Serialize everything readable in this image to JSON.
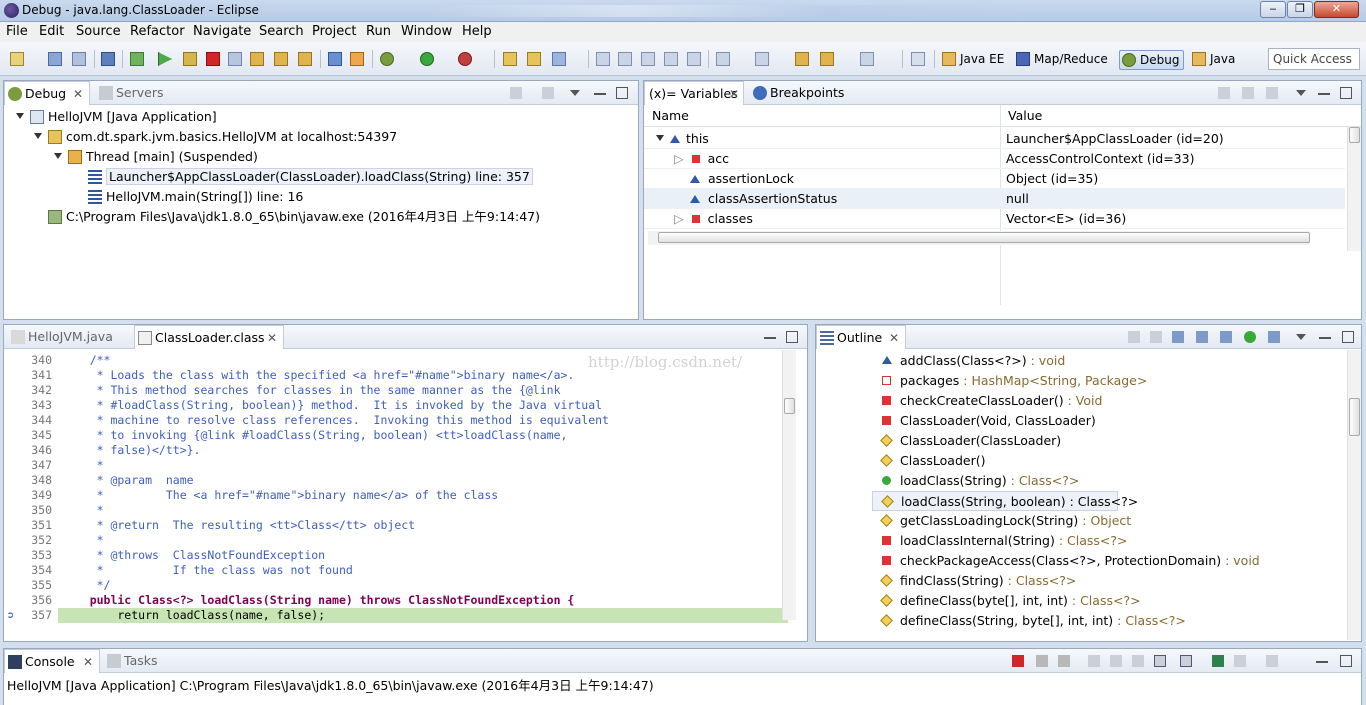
{
  "window": {
    "title": "Debug - java.lang.ClassLoader - Eclipse",
    "minimize": "‒",
    "maximize": "❐",
    "close": "✕"
  },
  "menu": [
    "File",
    "Edit",
    "Source",
    "Refactor",
    "Navigate",
    "Search",
    "Project",
    "Run",
    "Window",
    "Help"
  ],
  "perspectives": [
    "Java EE",
    "Map/Reduce",
    "Debug",
    "Java"
  ],
  "quick_access": "Quick Access",
  "debug_panel": {
    "tabs": [
      "Debug",
      "Servers"
    ],
    "tree": [
      "HelloJVM [Java Application]",
      "com.dt.spark.jvm.basics.HelloJVM at localhost:54397",
      "Thread [main] (Suspended)",
      "Launcher$AppClassLoader(ClassLoader).loadClass(String) line: 357",
      "HelloJVM.main(String[]) line: 16",
      "C:\\Program Files\\Java\\jdk1.8.0_65\\bin\\javaw.exe (2016年4月3日 上午9:14:47)"
    ]
  },
  "variables_panel": {
    "tabs": [
      "(x)= Variables",
      "Breakpoints"
    ],
    "columns": [
      "Name",
      "Value"
    ],
    "rows": [
      {
        "name": "this",
        "value": "Launcher$AppClassLoader  (id=20)"
      },
      {
        "name": "acc",
        "value": "AccessControlContext  (id=33)"
      },
      {
        "name": "assertionLock",
        "value": "Object  (id=35)"
      },
      {
        "name": "classAssertionStatus",
        "value": "null"
      },
      {
        "name": "classes",
        "value": "Vector<E>  (id=36)"
      }
    ]
  },
  "editor": {
    "tabs": [
      "HelloJVM.java",
      "ClassLoader.class"
    ],
    "watermark": "http://blog.csdn.net/",
    "lines": [
      {
        "n": "340",
        "text": "    /**"
      },
      {
        "n": "341",
        "text": "     * Loads the class with the specified <a href=\"#name\">binary name</a>."
      },
      {
        "n": "342",
        "text": "     * This method searches for classes in the same manner as the {@link"
      },
      {
        "n": "343",
        "text": "     * #loadClass(String, boolean)} method.  It is invoked by the Java virtual"
      },
      {
        "n": "344",
        "text": "     * machine to resolve class references.  Invoking this method is equivalent"
      },
      {
        "n": "345",
        "text": "     * to invoking {@link #loadClass(String, boolean) <tt>loadClass(name,"
      },
      {
        "n": "346",
        "text": "     * false)</tt>}."
      },
      {
        "n": "347",
        "text": "     *"
      },
      {
        "n": "348",
        "text": "     * @param  name"
      },
      {
        "n": "349",
        "text": "     *         The <a href=\"#name\">binary name</a> of the class"
      },
      {
        "n": "350",
        "text": "     *"
      },
      {
        "n": "351",
        "text": "     * @return  The resulting <tt>Class</tt> object"
      },
      {
        "n": "352",
        "text": "     *"
      },
      {
        "n": "353",
        "text": "     * @throws  ClassNotFoundException"
      },
      {
        "n": "354",
        "text": "     *          If the class was not found"
      },
      {
        "n": "355",
        "text": "     */"
      },
      {
        "n": "356",
        "text": "    public Class<?> loadClass(String name) throws ClassNotFoundException {"
      },
      {
        "n": "357",
        "text": "        return loadClass(name, false);"
      }
    ]
  },
  "outline_panel": {
    "tabs": [
      "Outline"
    ],
    "items": [
      {
        "name": "addClass(Class<?>)",
        "type": " : void"
      },
      {
        "name": "packages",
        "type": " : HashMap<String, Package>"
      },
      {
        "name": "checkCreateClassLoader()",
        "type": " : Void"
      },
      {
        "name": "ClassLoader(Void, ClassLoader)",
        "type": ""
      },
      {
        "name": "ClassLoader(ClassLoader)",
        "type": ""
      },
      {
        "name": "ClassLoader()",
        "type": ""
      },
      {
        "name": "loadClass(String)",
        "type": " : Class<?>"
      },
      {
        "name": "loadClass(String, boolean)",
        "type": " : Class<?>"
      },
      {
        "name": "getClassLoadingLock(String)",
        "type": " : Object"
      },
      {
        "name": "loadClassInternal(String)",
        "type": " : Class<?>"
      },
      {
        "name": "checkPackageAccess(Class<?>, ProtectionDomain)",
        "type": " : void"
      },
      {
        "name": "findClass(String)",
        "type": " : Class<?>"
      },
      {
        "name": "defineClass(byte[], int, int)",
        "type": " : Class<?>"
      },
      {
        "name": "defineClass(String, byte[], int, int)",
        "type": " : Class<?>"
      }
    ]
  },
  "console_panel": {
    "tabs": [
      "Console",
      "Tasks"
    ],
    "text": "HelloJVM [Java Application] C:\\Program Files\\Java\\jdk1.8.0_65\\bin\\javaw.exe (2016年4月3日 上午9:14:47)"
  },
  "colors": {
    "highlight_line": "#c8e4b4",
    "comment": "#3f5fbf",
    "keyword": "#7f0055"
  }
}
